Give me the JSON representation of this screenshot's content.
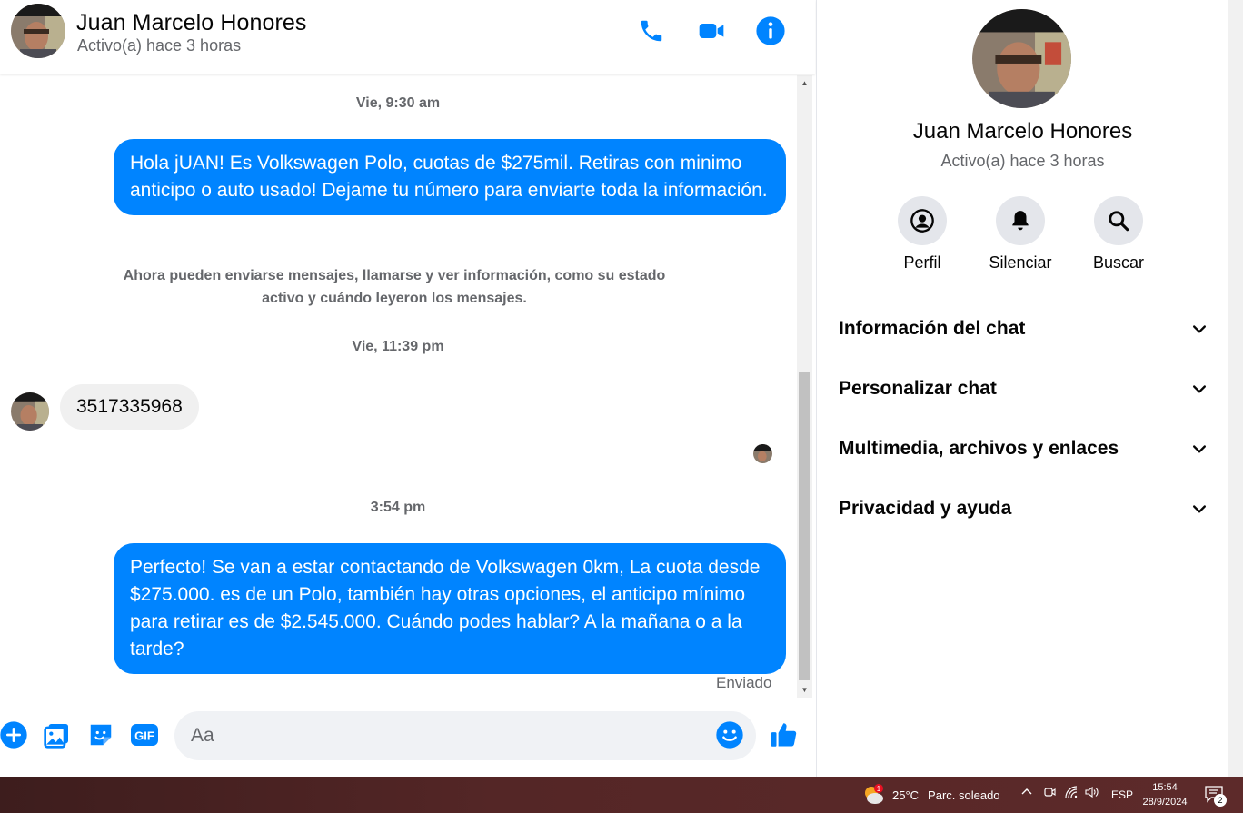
{
  "contact": {
    "name": "Juan Marcelo Honores",
    "status": "Activo(a) hace 3 horas"
  },
  "messages": {
    "ts1": "Vie, 9:30 am",
    "msg1": "Hola jUAN! Es Volkswagen Polo, cuotas de $275mil. Retiras con minimo anticipo o auto usado! Dejame tu número para enviarte toda la información.",
    "system_note_line1": "Ahora pueden enviarse mensajes, llamarse y ver información, como su estado",
    "system_note_line2": "activo y cuándo leyeron los mensajes.",
    "ts2": "Vie, 11:39 pm",
    "msg2": "3517335968",
    "ts3": "3:54 pm",
    "msg3": "Perfecto!  Se van a estar contactando de Volkswagen 0km, La cuota desde $275.000. es de un Polo, también hay otras opciones, el anticipo mínimo para retirar es de $2.545.000. Cuándo podes hablar? A la mañana o a la tarde?",
    "sent_label": "Enviado"
  },
  "composer": {
    "placeholder": "Aa",
    "gif_label": "GIF"
  },
  "side": {
    "actions": [
      {
        "label": "Perfil",
        "icon": "profile-icon"
      },
      {
        "label": "Silenciar",
        "icon": "bell-icon"
      },
      {
        "label": "Buscar",
        "icon": "search-icon"
      }
    ],
    "sections": [
      {
        "title": "Información del chat"
      },
      {
        "title": "Personalizar chat"
      },
      {
        "title": "Multimedia, archivos y enlaces"
      },
      {
        "title": "Privacidad y ayuda"
      }
    ]
  },
  "taskbar": {
    "temperature": "25°C",
    "condition": "Parc. soleado",
    "weather_badge": "1",
    "language": "ESP",
    "time": "15:54",
    "date": "28/9/2024",
    "notification_count": "2"
  },
  "colors": {
    "accent": "#0084ff",
    "bubble_in": "#f0f0f0",
    "secondary_text": "#65676b"
  }
}
